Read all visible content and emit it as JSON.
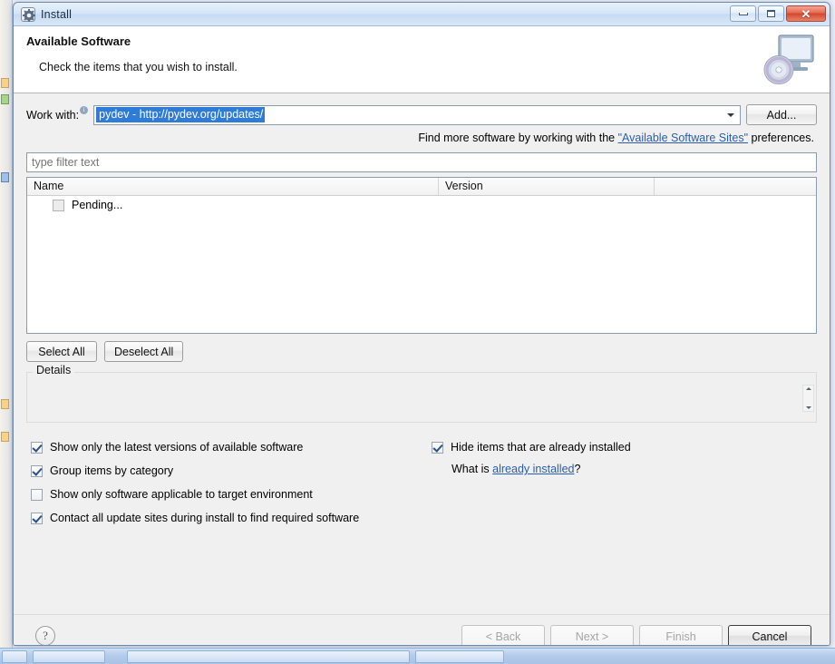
{
  "window": {
    "title": "Install",
    "icon": "install-gear-icon",
    "controls": {
      "minimize": "minimize-icon",
      "maximize": "maximize-icon",
      "close": "close-icon",
      "close_glyph": "✕"
    }
  },
  "banner": {
    "title": "Available Software",
    "subtitle": "Check the items that you wish to install.",
    "icon": "monitor-disc-icon"
  },
  "work_with": {
    "label": "Work with:",
    "info_glyph": "i",
    "value": "pydev - http://pydev.org/updates/",
    "add_button": "Add...",
    "dropdown_icon": "chevron-down-icon"
  },
  "find_more": {
    "prefix": "Find more software by working with the ",
    "link": "\"Available Software Sites\"",
    "suffix": " preferences."
  },
  "filter": {
    "placeholder": "type filter text",
    "value": ""
  },
  "table": {
    "columns": [
      "Name",
      "Version",
      ""
    ],
    "rows": [
      {
        "name": "Pending...",
        "version": "",
        "checked": false,
        "enabled": false
      }
    ]
  },
  "selection_buttons": {
    "select_all": "Select All",
    "deselect_all": "Deselect All"
  },
  "details": {
    "legend": "Details",
    "text": "",
    "scroll_up_icon": "scroll-up-arrow-icon",
    "scroll_down_icon": "scroll-down-arrow-icon"
  },
  "options": {
    "left": [
      {
        "label": "Show only the latest versions of available software",
        "checked": true
      },
      {
        "label": "Group items by category",
        "checked": true
      },
      {
        "label": "Show only software applicable to target environment",
        "checked": false
      },
      {
        "label": "Contact all update sites during install to find required software",
        "checked": true
      }
    ],
    "right": [
      {
        "label": "Hide items that are already installed",
        "checked": true
      }
    ],
    "what_is": {
      "prefix": "What is ",
      "link": "already installed",
      "suffix": "?"
    }
  },
  "footer": {
    "help": "?",
    "back": "< Back",
    "next": "Next >",
    "finish": "Finish",
    "cancel": "Cancel"
  },
  "colors": {
    "selection_blue": "#2f7bd8",
    "link_blue": "#2a5db0",
    "close_red": "#d2472c",
    "dialog_bg": "#f0f0f0"
  }
}
